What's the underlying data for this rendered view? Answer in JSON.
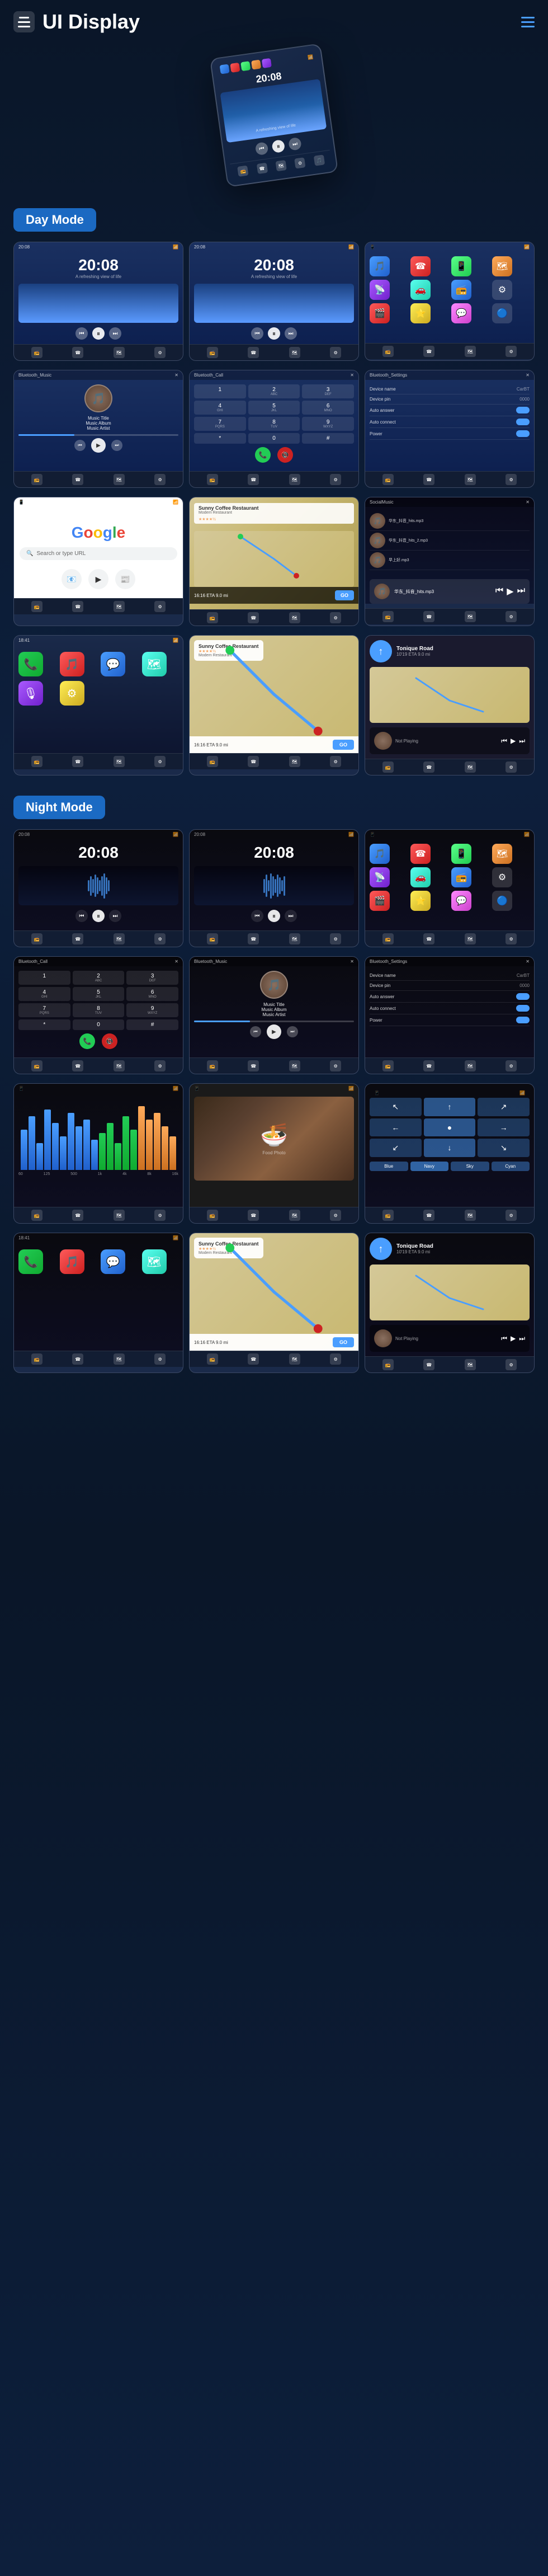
{
  "header": {
    "title": "UI Display",
    "menu_icon": "menu",
    "nav_icon": "hamburger-nav"
  },
  "day_mode": {
    "label": "Day Mode",
    "screens": [
      {
        "id": "day-music-1",
        "time": "20:08",
        "subtitle": "A refreshing view of life"
      },
      {
        "id": "day-music-2",
        "time": "20:08",
        "subtitle": "A refreshing view of life"
      },
      {
        "id": "day-apps",
        "type": "apps"
      },
      {
        "id": "day-bluetooth-music",
        "title": "Bluetooth_Music",
        "track": "Music Title",
        "album": "Music Album",
        "artist": "Music Artist"
      },
      {
        "id": "day-bluetooth-call",
        "title": "Bluetooth_Call"
      },
      {
        "id": "day-bluetooth-settings",
        "title": "Bluetooth_Settings",
        "settings": [
          {
            "label": "Device name",
            "value": "CarBT"
          },
          {
            "label": "Device pin",
            "value": "0000"
          },
          {
            "label": "Auto answer",
            "value": "toggle-on"
          },
          {
            "label": "Auto connect",
            "value": "toggle-on"
          },
          {
            "label": "Power",
            "value": "toggle-on"
          }
        ]
      },
      {
        "id": "day-google",
        "type": "google"
      },
      {
        "id": "day-map",
        "type": "map"
      },
      {
        "id": "day-social",
        "title": "SocialMusic",
        "tracks": [
          "华东_抖音_hits.mp3",
          "华东_抖音_hits_2.mp3",
          "早上好.mp3"
        ]
      }
    ]
  },
  "carplay": {
    "screens": [
      {
        "id": "carplay-home",
        "apps": [
          "phone",
          "music",
          "maps",
          "messages",
          "podcasts",
          "settings"
        ]
      },
      {
        "id": "carplay-map",
        "destination": "Sunny Coffee Restaurant",
        "rating": "4.5",
        "address": "Modern Restaurant",
        "eta": "16:16 ETA",
        "distance": "9.0 mi"
      },
      {
        "id": "carplay-nav",
        "street": "Tonique Road",
        "distance": "10'19 ETA  9.0 mi"
      }
    ]
  },
  "night_mode": {
    "label": "Night Mode",
    "screens": [
      {
        "id": "night-music-1",
        "time": "20:08"
      },
      {
        "id": "night-music-2",
        "time": "20:08"
      },
      {
        "id": "night-apps",
        "type": "apps"
      },
      {
        "id": "night-bluetooth-call",
        "title": "Bluetooth_Call"
      },
      {
        "id": "night-bluetooth-music",
        "title": "Bluetooth_Music",
        "track": "Music Title",
        "album": "Music Album",
        "artist": "Music Artist"
      },
      {
        "id": "night-bluetooth-settings",
        "title": "Bluetooth_Settings",
        "settings": [
          {
            "label": "Device name",
            "value": "CarBT"
          },
          {
            "label": "Device pin",
            "value": "0000"
          },
          {
            "label": "Auto answer",
            "value": "toggle-on"
          },
          {
            "label": "Auto connect",
            "value": "toggle-on"
          },
          {
            "label": "Power",
            "value": "toggle-on"
          }
        ]
      },
      {
        "id": "night-camera",
        "type": "camera"
      },
      {
        "id": "night-food",
        "type": "food-photo"
      },
      {
        "id": "night-nav-arrows",
        "type": "nav-arrows"
      },
      {
        "id": "night-carplay-home",
        "apps": [
          "phone",
          "music",
          "maps",
          "messages"
        ]
      },
      {
        "id": "night-map",
        "destination": "Sunny Coffee Restaurant",
        "rating": "4.5",
        "address": "Modern Restaurant",
        "eta": "16:16 ETA",
        "distance": "9.0 mi"
      },
      {
        "id": "night-nav",
        "street": "Tonique Road"
      }
    ]
  },
  "bottom_nav": {
    "items": [
      "📻",
      "☎",
      "🗺",
      "⚙",
      "🎵",
      "📱"
    ]
  },
  "dial_keys": [
    [
      "1",
      "2",
      "3"
    ],
    [
      "4",
      "5",
      "6"
    ],
    [
      "7",
      "8",
      "9"
    ],
    [
      "*",
      "0",
      "#"
    ]
  ]
}
